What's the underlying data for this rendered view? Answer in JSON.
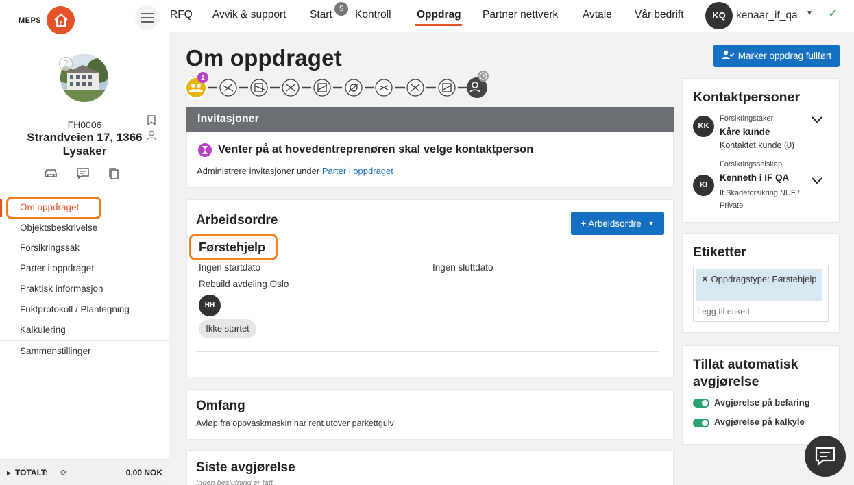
{
  "brand": {
    "name": "MEPS",
    "accent": "#e4522a"
  },
  "sidebar": {
    "property_id": "FH0006",
    "address": "Strandveien 17, 1366 Lysaker",
    "nav": [
      {
        "label": "Om oppdraget",
        "active": true
      },
      {
        "label": "Objektsbeskrivelse"
      },
      {
        "label": "Forsikringssak"
      },
      {
        "label": "Parter i oppdraget"
      },
      {
        "label": "Praktisk informasjon"
      },
      {
        "label": "Fuktprotokoll / Plantegning"
      },
      {
        "label": "Kalkulering"
      },
      {
        "label": "Sammenstillinger"
      }
    ],
    "footer": {
      "label": "TOTALT:",
      "value": "0,00 NOK"
    }
  },
  "topnav": {
    "items": [
      "RFQ",
      "Avvik & support",
      "Start",
      "Kontroll",
      "Oppdrag",
      "Partner nettverk",
      "Avtale",
      "Vår bedrift"
    ],
    "active": "Oppdrag",
    "start_badge": "5",
    "user_initials": "KQ",
    "username": "kenaar_if_qa"
  },
  "page": {
    "title": "Om oppdraget",
    "complete_button": "Marker oppdrag fullført"
  },
  "invitations": {
    "header": "Invitasjoner",
    "status": "Venter på at hovedentreprenøren skal velge kontaktperson",
    "hint_prefix": "Administrere invitasjoner under ",
    "hint_link": "Parter i oppdraget"
  },
  "workorder": {
    "title": "Arbeidsordre",
    "add_button": "+ Arbeidsordre",
    "item_title": "Førstehjelp",
    "start_date": "Ingen startdato",
    "end_date": "Ingen sluttdato",
    "org": "Rebuild avdeling Oslo",
    "assignee_initials": "HH",
    "status": "Ikke startet"
  },
  "scope": {
    "title": "Omfang",
    "text": "Avløp fra oppvaskmaskin har rent utover parkettgulv"
  },
  "last_decision": {
    "title": "Siste avgjørelse",
    "text": "Ingen beslutning er tatt"
  },
  "contacts": {
    "title": "Kontaktpersoner",
    "list": [
      {
        "initials": "KK",
        "role": "Forsikringstaker",
        "name": "Kåre kunde",
        "detail": "Kontaktet kunde (0)"
      },
      {
        "initials": "KI",
        "role": "Forsikringsselskap",
        "name": "Kenneth i IF QA",
        "detail": "If Skadeforsikring NUF / Private"
      }
    ]
  },
  "labels": {
    "title": "Etiketter",
    "tag": "Oppdragstype: Førstehjelp",
    "add_placeholder": "Legg til etikett"
  },
  "auto_decision": {
    "title": "Tillat automatisk avgjørelse",
    "options": [
      {
        "label": "Avgjørelse på befaring",
        "on": true
      },
      {
        "label": "Avgjørelse på kalkyle",
        "on": true
      }
    ]
  },
  "icons": {
    "menu": "hamburger-icon",
    "chat": "chat-icon",
    "bookmark": "bookmark-icon",
    "check": "check-icon"
  }
}
